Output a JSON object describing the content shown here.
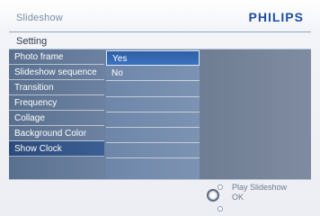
{
  "header": {
    "app_title": "Slideshow",
    "brand": "PHILIPS"
  },
  "section": {
    "title": "Setting"
  },
  "menu": {
    "items": [
      {
        "label": "Photo frame"
      },
      {
        "label": "Slideshow sequence"
      },
      {
        "label": "Transition"
      },
      {
        "label": "Frequency"
      },
      {
        "label": "Collage"
      },
      {
        "label": "Background Color"
      },
      {
        "label": "Show Clock"
      }
    ],
    "active_label": "Show Clock"
  },
  "options": {
    "items": [
      {
        "label": "Yes"
      },
      {
        "label": "No"
      }
    ],
    "selected_label": "Yes"
  },
  "footer": {
    "play_hint": "Play Slideshow",
    "ok_hint": "OK"
  },
  "colors": {
    "brand": "#1f4fa5",
    "active_item": "#2c4a7a",
    "selected_option": "#2e5fa3"
  },
  "icons": {
    "up_hint": "small-circle-icon",
    "ok_hint": "ring-button-icon",
    "down_hint": "small-circle-icon"
  }
}
